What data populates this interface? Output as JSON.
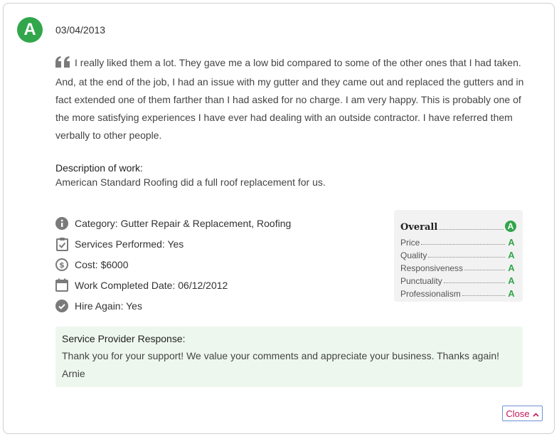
{
  "review": {
    "grade": "A",
    "date": "03/04/2013",
    "text": "I really liked them a lot. They gave me a low bid compared to some of the other ones that I had taken. And, at the end of the job, I had an issue with my gutter and they came out and replaced the gutters and in fact extended one of them farther than I had asked for no charge. I am very happy. This is probably one of the more satisfying experiences I have ever had dealing with an outside contractor. I have referred them verbally to other people.",
    "description_title": "Description of work:",
    "description_text": "American Standard Roofing did a full roof replacement for us."
  },
  "details": {
    "category": "Category: Gutter Repair & Replacement, Roofing",
    "services": "Services Performed: Yes",
    "cost": "Cost: $6000",
    "completed": "Work Completed Date: 06/12/2012",
    "hire_again": "Hire Again: Yes"
  },
  "grades": {
    "overall_label": "Overall",
    "overall": "A",
    "items": [
      {
        "label": "Price",
        "grade": "A"
      },
      {
        "label": "Quality",
        "grade": "A"
      },
      {
        "label": "Responsiveness",
        "grade": "A"
      },
      {
        "label": "Punctuality",
        "grade": "A"
      },
      {
        "label": "Professionalism",
        "grade": "A"
      }
    ]
  },
  "response": {
    "title": "Service Provider Response:",
    "text": "Thank you for your support! We value your comments and appreciate your business. Thanks again!",
    "signature": "Arnie"
  },
  "close_label": "Close",
  "colors": {
    "grade_green": "#31a64a",
    "response_bg": "#eef7ee",
    "close_text": "#c2185b",
    "icon_gray": "#7a7a7a"
  }
}
